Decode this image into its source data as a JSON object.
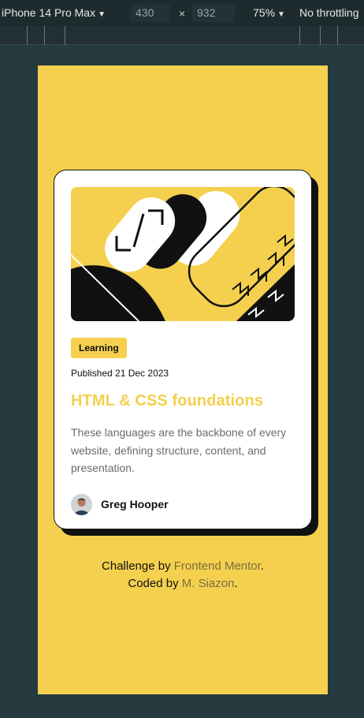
{
  "devtools": {
    "device": "iPhone 14 Pro Max",
    "width": "430",
    "times": "×",
    "height": "932",
    "zoom": "75%",
    "throttle": "No throttling",
    "caret": "▼"
  },
  "card": {
    "tag": "Learning",
    "published": "Published 21 Dec 2023",
    "title": "HTML & CSS foundations",
    "description": "These languages are the backbone of every website, defining structure, content, and presentation.",
    "author": "Greg Hooper"
  },
  "attribution": {
    "prefix": "Challenge by ",
    "challenge_link": "Frontend Mentor",
    "period1": ".",
    "coded_prefix": "Coded by ",
    "coder_link": "M. Siazon",
    "period2": "."
  },
  "colors": {
    "page_bg": "#263b3f",
    "viewport_bg": "#f4d04e",
    "accent": "#f4d04e",
    "card_bg": "#ffffff",
    "text_dark": "#111111",
    "text_muted": "#6b6b6b"
  }
}
